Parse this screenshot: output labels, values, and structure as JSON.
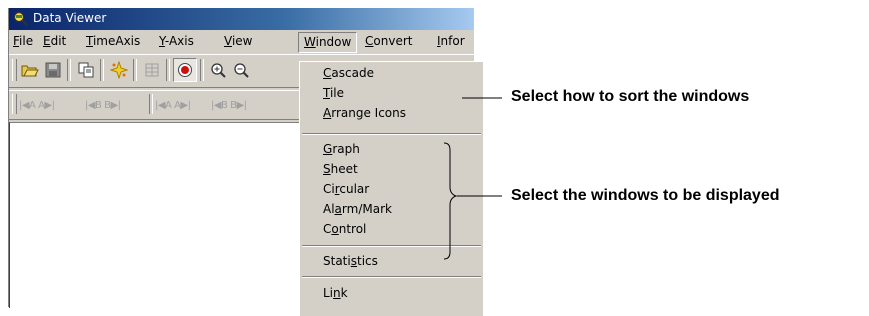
{
  "window": {
    "title": "Data Viewer"
  },
  "menu": [
    {
      "label": "File",
      "key": "F",
      "rest": "ile"
    },
    {
      "label": "Edit",
      "key": "E",
      "rest": "dit"
    },
    {
      "label": "TimeAxis",
      "key": "T",
      "rest": "imeAxis"
    },
    {
      "label": "Y-Axis",
      "key": "Y",
      "rest": "-Axis"
    },
    {
      "label": "View",
      "key": "V",
      "rest": "iew"
    },
    {
      "label": "Window",
      "key": "W",
      "rest": "indow"
    },
    {
      "label": "Convert",
      "key": "C",
      "rest": "onvert"
    },
    {
      "label": "Infor",
      "key": "I",
      "rest": "nfor"
    }
  ],
  "toolbar1": [
    "open-icon",
    "save-icon",
    "copy-icon",
    "sparkle-icon",
    "grid-icon",
    "record-icon",
    "zoom-in-icon",
    "zoom-out-icon"
  ],
  "toolbar2": {
    "nav": [
      "|◀A A▶|",
      "|◀B B▶|",
      "|◀A A▶|",
      "|◀B B▶|"
    ]
  },
  "window_menu": {
    "group1": [
      {
        "pre": "",
        "key": "C",
        "post": "ascade"
      },
      {
        "pre": "",
        "key": "T",
        "post": "ile"
      },
      {
        "pre": "",
        "key": "A",
        "post": "rrange Icons"
      }
    ],
    "group2": [
      {
        "pre": "",
        "key": "G",
        "post": "raph"
      },
      {
        "pre": "",
        "key": "S",
        "post": "heet"
      },
      {
        "pre": "Ci",
        "key": "r",
        "post": "cular"
      },
      {
        "pre": "Al",
        "key": "a",
        "post": "rm/Mark"
      },
      {
        "pre": "C",
        "key": "o",
        "post": "ntrol"
      }
    ],
    "group3": [
      {
        "pre": "Stati",
        "key": "s",
        "post": "tics"
      }
    ],
    "group4": [
      {
        "pre": "Li",
        "key": "n",
        "post": "k"
      }
    ]
  },
  "annotations": {
    "sort": "Select how to sort the windows",
    "display": "Select the windows to be displayed"
  }
}
